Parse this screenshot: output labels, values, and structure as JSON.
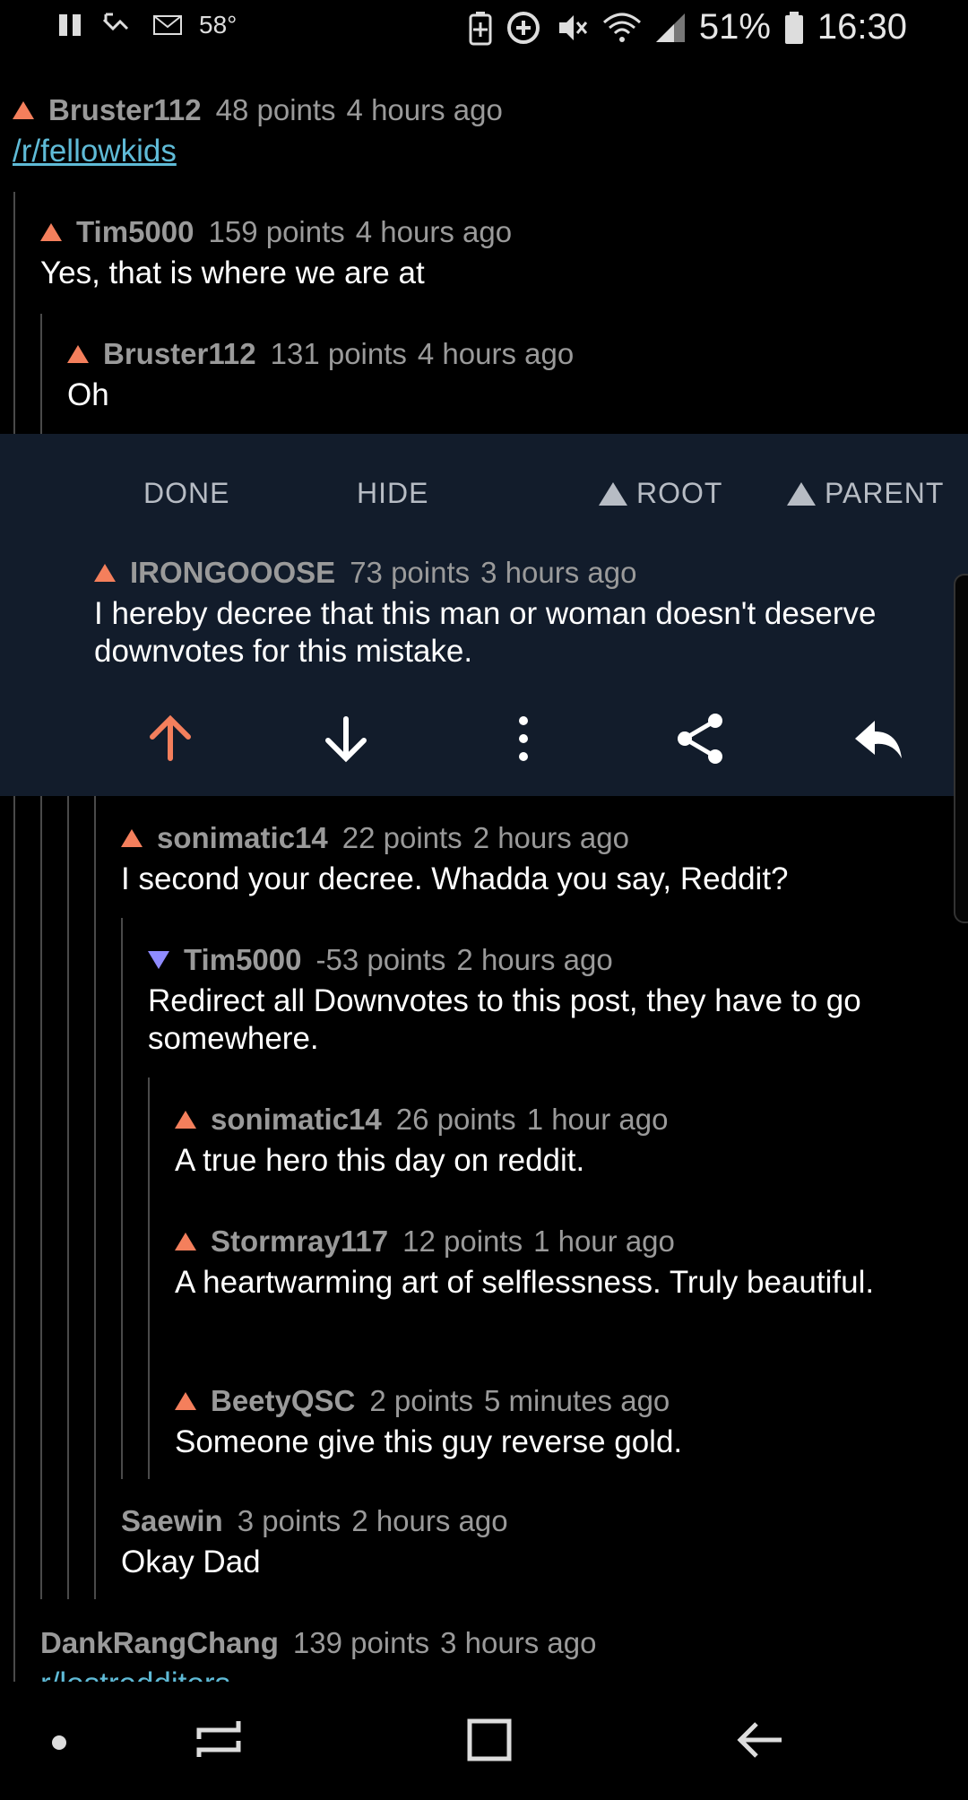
{
  "status_bar": {
    "temperature": "58°",
    "battery": "51%",
    "time": "16:30"
  },
  "comments": [
    {
      "author": "Bruster112",
      "points": "48 points",
      "time": "4 hours ago",
      "link": "/r/fellowkids",
      "vote": "up"
    },
    {
      "author": "Tim5000",
      "points": "159 points",
      "time": "4 hours ago",
      "body": "Yes, that is where we are at",
      "vote": "up"
    },
    {
      "author": "Bruster112",
      "points": "131 points",
      "time": "4 hours ago",
      "body": "Oh",
      "vote": "up"
    },
    {
      "author": "IRONGOOOSE",
      "points": "73 points",
      "time": "3 hours ago",
      "body": "I hereby decree that this man or woman doesn't deserve downvotes for this mistake.",
      "vote": "up"
    },
    {
      "author": "sonimatic14",
      "points": "22 points",
      "time": "2 hours ago",
      "body": "I second your decree. Whadda you say, Reddit?",
      "vote": "up"
    },
    {
      "author": "Tim5000",
      "points": "-53 points",
      "time": "2 hours ago",
      "body": "Redirect all Downvotes to this post, they have to go somewhere.",
      "vote": "down"
    },
    {
      "author": "sonimatic14",
      "points": "26 points",
      "time": "1 hour ago",
      "body": "A true hero this day on reddit.",
      "vote": "up"
    },
    {
      "author": "Stormray117",
      "points": "12 points",
      "time": "1 hour ago",
      "body": "A heartwarming art of selflessness. Truly beautiful.",
      "vote": "up"
    },
    {
      "author": "BeetyQSC",
      "points": "2 points",
      "time": "5 minutes ago",
      "body": "Someone give this guy reverse gold.",
      "vote": "up"
    },
    {
      "author": "Saewin",
      "points": "3 points",
      "time": "2 hours ago",
      "body": "Okay Dad",
      "vote": "none"
    },
    {
      "author": "DankRangChang",
      "points": "139 points",
      "time": "3 hours ago",
      "link": "r/lostredditors",
      "vote": "none"
    }
  ],
  "selected_toolbar": {
    "done": "DONE",
    "hide": "HIDE",
    "root": "ROOT",
    "parent": "PARENT"
  },
  "icons": {
    "upvote": "arrow-up-icon",
    "downvote": "arrow-down-icon",
    "more": "more-vert-icon",
    "share": "share-icon",
    "reply": "reply-icon"
  },
  "colors": {
    "upvote": "#f47f5c",
    "downvote": "#8f8bff",
    "link": "#5fbbd7",
    "selected_bg": "#121c2b"
  }
}
